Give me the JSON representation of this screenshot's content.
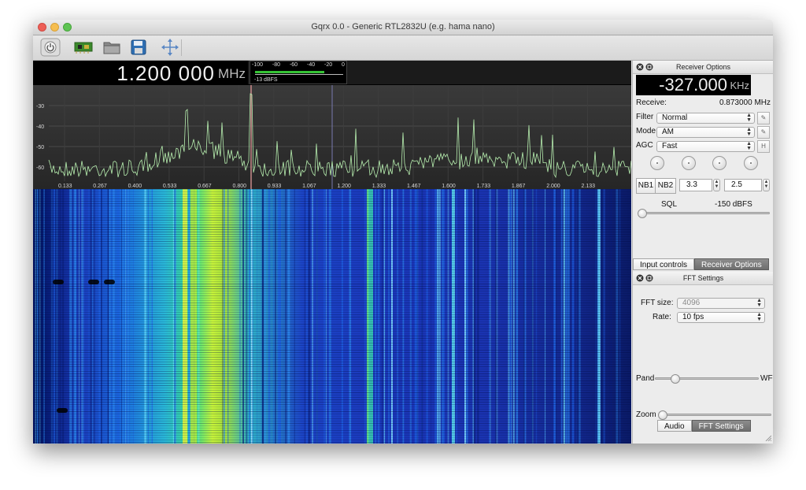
{
  "window": {
    "title": "Gqrx 0.0 - Generic RTL2832U (e.g. hama nano)"
  },
  "toolbar": {
    "buttons": [
      {
        "name": "power-button",
        "icon": "power-icon"
      },
      {
        "name": "input-device-button",
        "icon": "circuit-board-icon"
      },
      {
        "name": "open-folder-button",
        "icon": "folder-icon"
      },
      {
        "name": "save-button",
        "icon": "floppy-disk-icon"
      },
      {
        "name": "move-button",
        "icon": "move-arrows-icon"
      }
    ]
  },
  "freq_display": {
    "value": "1.200 000",
    "unit": "MHz"
  },
  "signal_meter": {
    "ticks": [
      "-100",
      "-80",
      "-60",
      "-40",
      "-20",
      "0"
    ],
    "level_text": "-13 dBFS",
    "level_dbfs": -13
  },
  "spectrum": {
    "y_ticks": [
      "-30",
      "-40",
      "-50",
      "-60"
    ],
    "x_ticks": [
      "0.133",
      "0.267",
      "0.400",
      "0.533",
      "0.667",
      "0.800",
      "0.933",
      "1.067",
      "1.200",
      "1.333",
      "1.467",
      "1.600",
      "1.733",
      "1.867",
      "2.000",
      "2.133"
    ],
    "trace_color": "#b8f0b0",
    "marker_color": "#c98a8a"
  },
  "receiver_options": {
    "title": "Receiver Options",
    "offset_value": "-327.000",
    "offset_unit": "KHz",
    "receive_label": "Receive:",
    "receive_value": "0.873000 MHz",
    "filter_label": "Filter",
    "filter_value": "Normal",
    "mode_label": "Mode",
    "mode_value": "AM",
    "agc_label": "AGC",
    "agc_value": "Fast",
    "agc_button": "H",
    "nb1_label": "NB1",
    "nb2_label": "NB2",
    "nb1_threshold": "3.3",
    "nb2_threshold": "2.5",
    "sql_label": "SQL",
    "sql_value": "-150 dBFS"
  },
  "upper_tabs": {
    "tabs": [
      "Input controls",
      "Receiver Options"
    ],
    "active": "Receiver Options"
  },
  "fft_settings": {
    "title": "FFT Settings",
    "fft_size_label": "FFT size:",
    "fft_size_value": "4096",
    "rate_label": "Rate:",
    "rate_value": "10 fps",
    "pand_label": "Pand",
    "wf_label": "WF",
    "zoom_label": "Zoom",
    "pand_wf_split": 0.15,
    "zoom_level": 0.0
  },
  "lower_tabs": {
    "tabs": [
      "Audio",
      "FFT Settings"
    ],
    "active": "FFT Settings"
  },
  "colors": {
    "waterfall_low": "#00007a",
    "waterfall_high": "#ffff00",
    "accent": "#35c335"
  }
}
